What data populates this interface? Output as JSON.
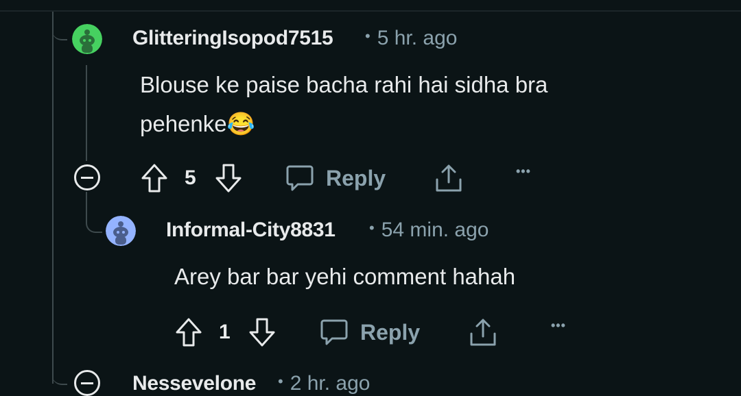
{
  "comments": [
    {
      "username": "GlitteringIsopod7515",
      "time": "5 hr. ago",
      "body_line1": "Blouse ke paise bacha rahi hai sidha bra",
      "body_line2": "pehenke",
      "emoji": "😂",
      "votes": "5",
      "reply_label": "Reply",
      "avatar_color": "#46d160"
    },
    {
      "username": "Informal-City8831",
      "time": "54 min. ago",
      "body": "Arey bar bar yehi comment hahah",
      "votes": "1",
      "reply_label": "Reply",
      "avatar_color": "#94b3ff"
    },
    {
      "username_partial": "Nessevelone",
      "time_partial": "2 hr. ago"
    }
  ],
  "meta_separator": "•",
  "more_label": "•••",
  "colors": {
    "background": "#0b1416",
    "text": "#e8eaeb",
    "muted": "#8ba2ad",
    "thread_line": "#3e4a4d"
  }
}
